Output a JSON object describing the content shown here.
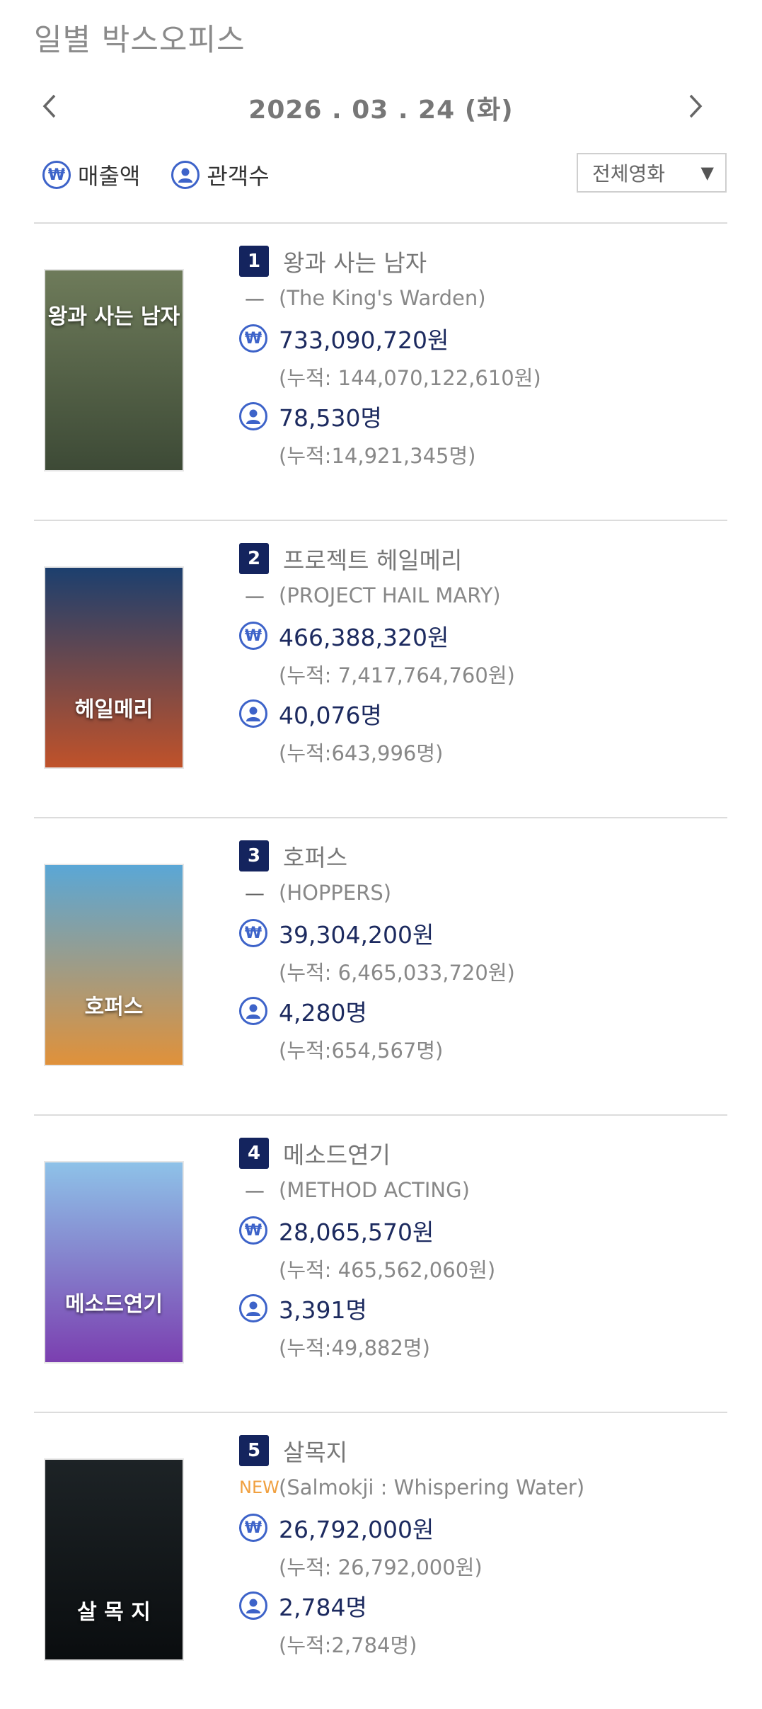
{
  "page_title": "일별 박스오피스",
  "date_nav": {
    "date": "2026 . 03 . 24  (화)",
    "prev_icon": "chevron-left-icon",
    "next_icon": "chevron-right-icon"
  },
  "legend": {
    "sales_label": "매출액",
    "audience_label": "관객수"
  },
  "filter": {
    "selected": "전체영화"
  },
  "colors": {
    "accent": "#3d63c9",
    "rank_bg": "#14245e",
    "value_text": "#1c2a5f",
    "new_badge": "#f0a040"
  },
  "movies": [
    {
      "rank": "1",
      "title_ko": "왕과 사는 남자",
      "change": "—",
      "title_en": "(The King's Warden)",
      "sales": "733,090,720원",
      "sales_cum": "(누적: 144,070,122,610원)",
      "audience": "78,530명",
      "audience_cum": "(누적:14,921,345명)",
      "poster_text": "왕과 사는 남자",
      "poster_colors": [
        "#6e7b5a",
        "#3d4a36"
      ]
    },
    {
      "rank": "2",
      "title_ko": "프로젝트 헤일메리",
      "change": "—",
      "title_en": "(PROJECT HAIL MARY)",
      "sales": "466,388,320원",
      "sales_cum": "(누적: 7,417,764,760원)",
      "audience": "40,076명",
      "audience_cum": "(누적:643,996명)",
      "poster_text": "헤일메리",
      "poster_colors": [
        "#1c3f6e",
        "#c0522a"
      ]
    },
    {
      "rank": "3",
      "title_ko": "호퍼스",
      "change": "—",
      "title_en": "(HOPPERS)",
      "sales": "39,304,200원",
      "sales_cum": "(누적: 6,465,033,720원)",
      "audience": "4,280명",
      "audience_cum": "(누적:654,567명)",
      "poster_text": "호퍼스",
      "poster_colors": [
        "#5aa7d6",
        "#e0913a"
      ]
    },
    {
      "rank": "4",
      "title_ko": "메소드연기",
      "change": "—",
      "title_en": "(METHOD ACTING)",
      "sales": "28,065,570원",
      "sales_cum": "(누적: 465,562,060원)",
      "audience": "3,391명",
      "audience_cum": "(누적:49,882명)",
      "poster_text": "메소드연기",
      "poster_colors": [
        "#8ec2e8",
        "#7b3fb0"
      ]
    },
    {
      "rank": "5",
      "title_ko": "살목지",
      "change": "NEW",
      "title_en": "(Salmokji : Whispering Water)",
      "sales": "26,792,000원",
      "sales_cum": "(누적: 26,792,000원)",
      "audience": "2,784명",
      "audience_cum": "(누적:2,784명)",
      "poster_text": "살 목 지",
      "poster_colors": [
        "#1d2326",
        "#0a0d0f"
      ]
    }
  ]
}
